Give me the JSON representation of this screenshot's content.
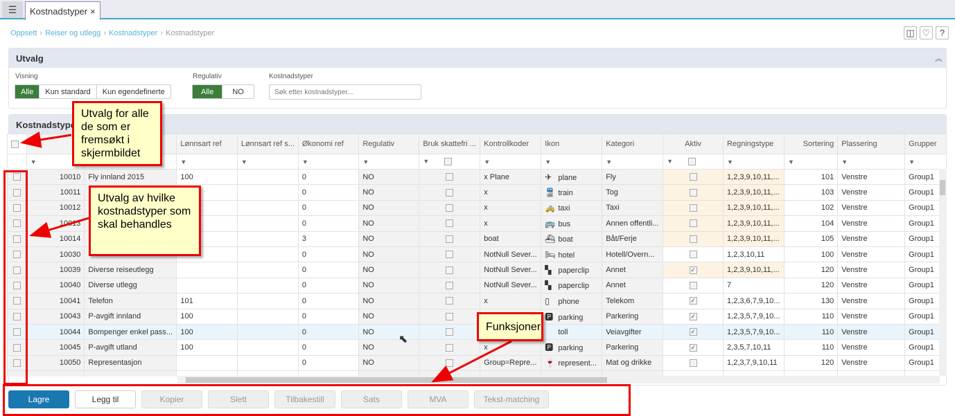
{
  "tab": {
    "title": "Kostnadstyper",
    "close": "×",
    "menu_icon": "list-icon"
  },
  "breadcrumb": [
    "Oppsett",
    "Reiser og utlegg",
    "Kostnadstyper",
    "Kostnadstyper"
  ],
  "toolbar": {
    "layout": "◫",
    "favorite": "♡",
    "help": "?"
  },
  "utvalg": {
    "title": "Utvalg",
    "collapse": "︽",
    "visning": {
      "label": "Visning",
      "options": [
        "Alle",
        "Kun standard",
        "Kun egendefinerte"
      ],
      "selected": "Alle"
    },
    "regulativ": {
      "label": "Regulativ",
      "options": [
        "Alle",
        "NO"
      ],
      "selected": "Alle"
    },
    "kostnadstyper": {
      "label": "Kostnadstyper",
      "placeholder": "Søk etter kostnadstyper..."
    }
  },
  "grid": {
    "title": "Kostnadstyper",
    "columns": [
      "",
      "",
      "",
      "Lønnsart ref",
      "Lønnsart ref s...",
      "Økonomi ref",
      "Regulativ",
      "Bruk skattefri ...",
      "Kontrollkoder",
      "Ikon",
      "Kategori",
      "Aktiv",
      "Regningstype",
      "Sortering",
      "Plassering",
      "Grupper"
    ],
    "rows": [
      {
        "id": "10010",
        "name": "Fly innland 2015",
        "lref": "100",
        "lrefs": "",
        "oko": "0",
        "reg": "NO",
        "skatt": false,
        "kk": "x Plane",
        "icon": "✈",
        "iname": "plane",
        "kat": "Fly",
        "aktiv": false,
        "regn": "1,2,3,9,10,11,...",
        "sort": "101",
        "plass": "Venstre",
        "grp": "Group1",
        "hl": true
      },
      {
        "id": "10011",
        "name": "",
        "lref": "",
        "lrefs": "",
        "oko": "0",
        "reg": "NO",
        "skatt": false,
        "kk": "x",
        "icon": "🚆",
        "iname": "train",
        "kat": "Tog",
        "aktiv": false,
        "regn": "1,2,3,9,10,11,...",
        "sort": "103",
        "plass": "Venstre",
        "grp": "Group1",
        "hl": true
      },
      {
        "id": "10012",
        "name": "",
        "lref": "",
        "lrefs": "",
        "oko": "0",
        "reg": "NO",
        "skatt": false,
        "kk": "x",
        "icon": "🚕",
        "iname": "taxi",
        "kat": "Taxi",
        "aktiv": false,
        "regn": "1,2,3,9,10,11,...",
        "sort": "102",
        "plass": "Venstre",
        "grp": "Group1",
        "hl": true
      },
      {
        "id": "10013",
        "name": "",
        "lref": "",
        "lrefs": "",
        "oko": "0",
        "reg": "NO",
        "skatt": false,
        "kk": "x",
        "icon": "🚌",
        "iname": "bus",
        "kat": "Annen offentli...",
        "aktiv": false,
        "regn": "1,2,3,9,10,11,...",
        "sort": "104",
        "plass": "Venstre",
        "grp": "Group1",
        "hl": true
      },
      {
        "id": "10014",
        "name": "",
        "lref": "",
        "lrefs": "",
        "oko": "3",
        "reg": "NO",
        "skatt": false,
        "kk": "boat",
        "icon": "⛴",
        "iname": "boat",
        "kat": "Båt/Ferje",
        "aktiv": false,
        "regn": "1,2,3,9,10,11,...",
        "sort": "105",
        "plass": "Venstre",
        "grp": "Group1",
        "hl": true
      },
      {
        "id": "10030",
        "name": "",
        "lref": "",
        "lrefs": "",
        "oko": "0",
        "reg": "NO",
        "skatt": false,
        "kk": "NotNull Sever...",
        "icon": "🛏",
        "iname": "hotel",
        "kat": "Hotell/Overn...",
        "aktiv": false,
        "regn": "1,2,3,10,11",
        "sort": "100",
        "plass": "Venstre",
        "grp": "Group1",
        "hl": false
      },
      {
        "id": "10039",
        "name": "Diverse reiseutlegg",
        "lref": "",
        "lrefs": "",
        "oko": "0",
        "reg": "NO",
        "skatt": false,
        "kk": "NotNull Sever...",
        "icon": "▚",
        "iname": "paperclip",
        "kat": "Annet",
        "aktiv": true,
        "regn": "1,2,3,9,10,11,...",
        "sort": "120",
        "plass": "Venstre",
        "grp": "Group1",
        "hl": true
      },
      {
        "id": "10040",
        "name": "Diverse utlegg",
        "lref": "",
        "lrefs": "",
        "oko": "0",
        "reg": "NO",
        "skatt": false,
        "kk": "NotNull Sever...",
        "icon": "▚",
        "iname": "paperclip",
        "kat": "Annet",
        "aktiv": false,
        "regn": "7",
        "sort": "120",
        "plass": "Venstre",
        "grp": "Group1",
        "hl": false
      },
      {
        "id": "10041",
        "name": "Telefon",
        "lref": "101",
        "lrefs": "",
        "oko": "0",
        "reg": "NO",
        "skatt": false,
        "kk": "x",
        "icon": "▯",
        "iname": "phone",
        "kat": "Telekom",
        "aktiv": true,
        "regn": "1,2,3,6,7,9,10...",
        "sort": "130",
        "plass": "Venstre",
        "grp": "Group1",
        "hl": false
      },
      {
        "id": "10043",
        "name": "P-avgift innland",
        "lref": "100",
        "lrefs": "",
        "oko": "0",
        "reg": "NO",
        "skatt": false,
        "kk": "",
        "icon": "🅿",
        "iname": "parking",
        "kat": "Parkering",
        "aktiv": true,
        "regn": "1,2,3,5,7,9,10...",
        "sort": "110",
        "plass": "Venstre",
        "grp": "Group1",
        "hl": false
      },
      {
        "id": "10044",
        "name": "Bompenger enkel pass...",
        "lref": "100",
        "lrefs": "",
        "oko": "0",
        "reg": "NO",
        "skatt": false,
        "kk": "",
        "icon": "",
        "iname": "toll",
        "kat": "Veiavgifter",
        "aktiv": true,
        "regn": "1,2,3,5,7,9,10...",
        "sort": "110",
        "plass": "Venstre",
        "grp": "Group1",
        "hl": false,
        "sel": true
      },
      {
        "id": "10045",
        "name": "P-avgift utland",
        "lref": "100",
        "lrefs": "",
        "oko": "0",
        "reg": "NO",
        "skatt": false,
        "kk": "x",
        "icon": "🅿",
        "iname": "parking",
        "kat": "Parkering",
        "aktiv": true,
        "regn": "2,3,5,7,10,11",
        "sort": "110",
        "plass": "Venstre",
        "grp": "Group1",
        "hl": false
      },
      {
        "id": "10050",
        "name": "Representasjon",
        "lref": "",
        "lrefs": "",
        "oko": "0",
        "reg": "NO",
        "skatt": false,
        "kk": "Group=Repre...",
        "icon": "🍷",
        "iname": "represent...",
        "kat": "Mat og drikke",
        "aktiv": false,
        "regn": "1,2,3,7,9,10,11",
        "sort": "120",
        "plass": "Venstre",
        "grp": "Group1",
        "hl": false
      }
    ]
  },
  "buttons": [
    "Lagre",
    "Legg til",
    "Kopier",
    "Slett",
    "Tilbakestill",
    "Sats",
    "MVA",
    "Tekst-matching"
  ],
  "callouts": {
    "select_all": "Utvalg for alle de som er fremsøkt i skjermbildet",
    "select_rows": "Utvalg av hvilke kostnadstyper som skal behandles",
    "functions": "Funksjoner"
  },
  "colors": {
    "primary": "#1a78b0",
    "selected_toggle": "#3b7d3b",
    "callout_border": "#e00000",
    "callout_bg": "#ffffc8"
  }
}
